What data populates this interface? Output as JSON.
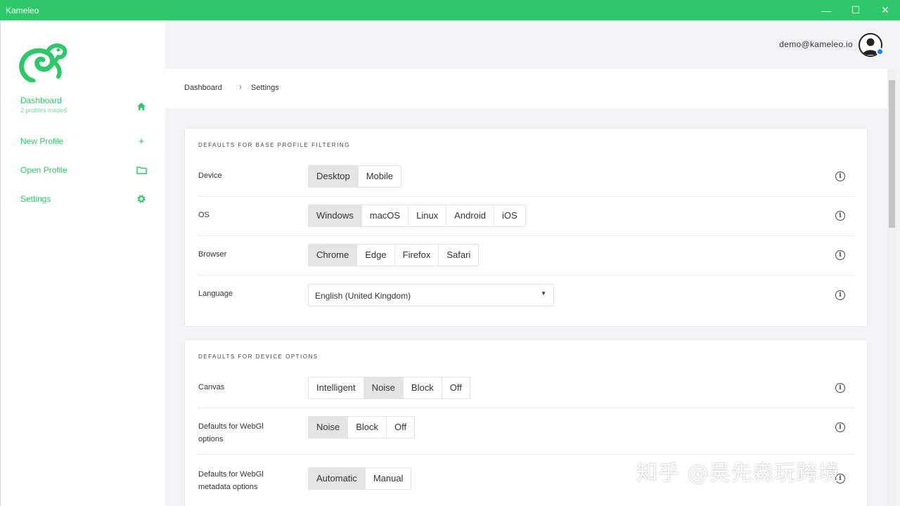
{
  "window": {
    "title": "Kameleo",
    "minimize": "—",
    "maximize": "☐",
    "close": "✕"
  },
  "sidebar": {
    "items": [
      {
        "label": "Dashboard",
        "sub": "2 profiles loaded",
        "icon": "home-icon"
      },
      {
        "label": "New Profile",
        "icon": "plus-icon"
      },
      {
        "label": "Open Profile",
        "icon": "folder-icon"
      },
      {
        "label": "Settings",
        "icon": "gear-icon"
      }
    ]
  },
  "header": {
    "user_email": "demo@kameleo.io"
  },
  "breadcrumb": {
    "items": [
      "Dashboard",
      "Settings"
    ],
    "separator": "›"
  },
  "sections": {
    "base_filtering": {
      "heading": "DEFAULTS FOR BASE PROFILE FILTERING",
      "device": {
        "label": "Device",
        "options": [
          "Desktop",
          "Mobile"
        ],
        "selected": "Desktop"
      },
      "os": {
        "label": "OS",
        "options": [
          "Windows",
          "macOS",
          "Linux",
          "Android",
          "iOS"
        ],
        "selected": "Windows"
      },
      "browser": {
        "label": "Browser",
        "options": [
          "Chrome",
          "Edge",
          "Firefox",
          "Safari"
        ],
        "selected": "Chrome"
      },
      "language": {
        "label": "Language",
        "value": "English (United Kingdom)"
      }
    },
    "device_options": {
      "heading": "DEFAULTS FOR DEVICE OPTIONS",
      "canvas": {
        "label": "Canvas",
        "options": [
          "Intelligent",
          "Noise",
          "Block",
          "Off"
        ],
        "selected": "Noise"
      },
      "webgl": {
        "label_line1": "Defaults for WebGl",
        "label_line2": "options",
        "options": [
          "Noise",
          "Block",
          "Off"
        ],
        "selected": "Noise"
      },
      "webgl_meta": {
        "label_line1": "Defaults for WebGl",
        "label_line2": "metadata options",
        "options": [
          "Automatic",
          "Manual"
        ],
        "selected": "Automatic"
      }
    }
  },
  "watermark": "知乎 @吴先森玩跨境",
  "colors": {
    "accent": "#2ec86a",
    "active_segment": "#e4e4e4",
    "avatar_status": "#1e7ff0"
  }
}
